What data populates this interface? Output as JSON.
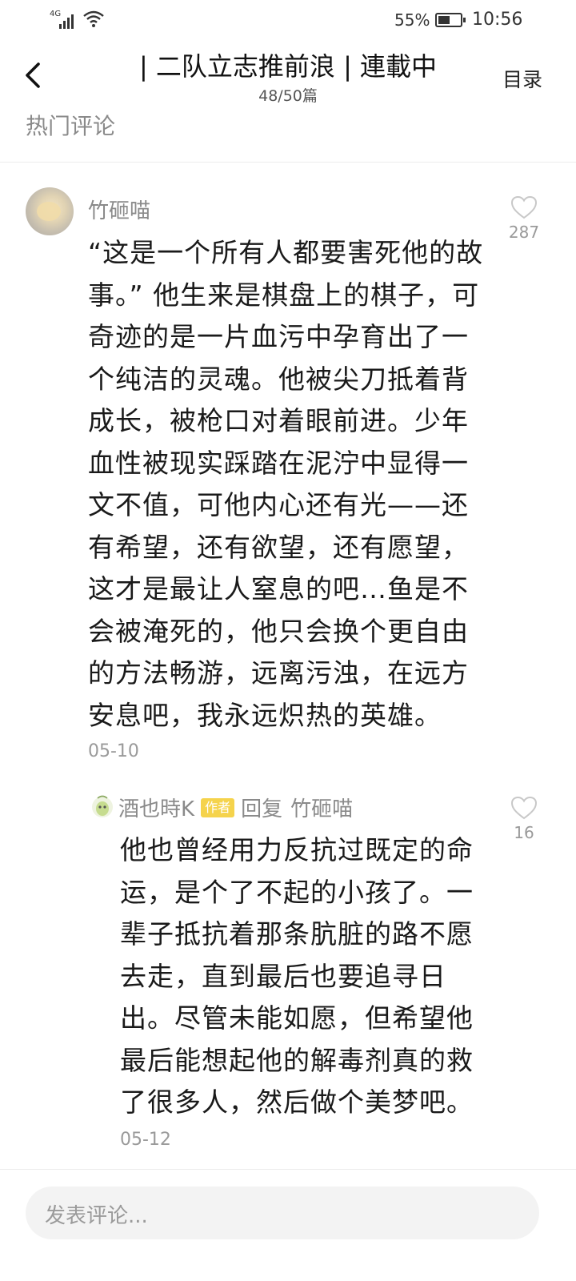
{
  "status_bar": {
    "network": "4G",
    "battery_percent": "55%",
    "time": "10:56"
  },
  "header": {
    "back_icon": "chevron-left-icon",
    "title": "| 二队立志推前浪 | 連載中",
    "progress": "48/50篇",
    "toc_label": "目录",
    "section_title": "热门评论"
  },
  "comment": {
    "username": "竹砸喵",
    "text": "“这是一个所有人都要害死他的故事。” 他生来是棋盘上的棋子，可奇迹的是一片血污中孕育出了一个纯洁的灵魂。他被尖刀抵着背成长，被枪口对着眼前进。少年血性被现实踩踏在泥泞中显得一文不值，可他内心还有光——还有希望，还有欲望，还有愿望，这才是最让人窒息的吧…鱼是不会被淹死的，他只会换个更自由的方法畅游，远离污浊，在远方安息吧，我永远炽热的英雄。",
    "date": "05-10",
    "likes": "287"
  },
  "reply": {
    "username": "酒也時K",
    "badge": "作者",
    "reply_word": "回复",
    "reply_to": "竹砸喵",
    "text": "他也曾经用力反抗过既定的命运，是个了不起的小孩了。一辈子抵抗着那条肮脏的路不愿去走，直到最后也要追寻日出。尽管未能如愿，但希望他最后能想起他的解毒剂真的救了很多人，然后做个美梦吧。",
    "date": "05-12",
    "likes": "16"
  },
  "input": {
    "placeholder": "发表评论..."
  },
  "colors": {
    "badge": "#f5d34c",
    "muted_text": "#8a8a8a",
    "input_bg": "#f3f3f3"
  }
}
